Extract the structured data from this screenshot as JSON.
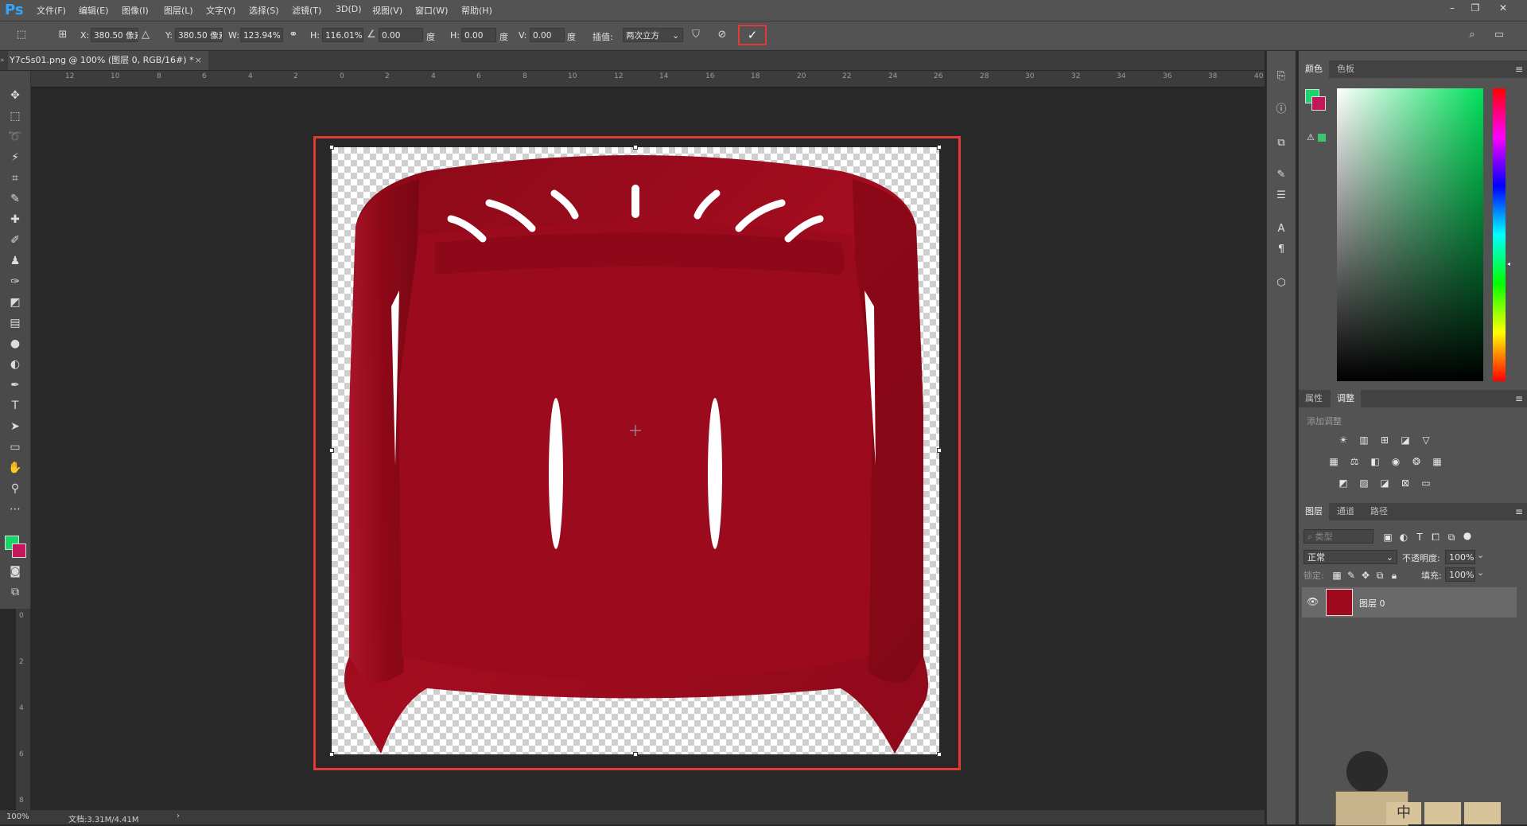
{
  "app": {
    "logo": "Ps"
  },
  "menubar": {
    "items": [
      "文件(F)",
      "编辑(E)",
      "图像(I)",
      "图层(L)",
      "文字(Y)",
      "选择(S)",
      "滤镜(T)",
      "3D(D)",
      "视图(V)",
      "窗口(W)",
      "帮助(H)"
    ]
  },
  "options": {
    "x_label": "X:",
    "x_value": "380.50 像素",
    "y_label": "Y:",
    "y_value": "380.50 像素",
    "w_label": "W:",
    "w_value": "123.94%",
    "h_label": "H:",
    "h_value": "116.01%",
    "angle_value": "0.00",
    "angle_unit": "度",
    "hskew_label": "H:",
    "hskew_value": "0.00",
    "hskew_unit": "度",
    "vskew_label": "V:",
    "vskew_value": "0.00",
    "vskew_unit": "度",
    "interp_label": "插值:",
    "interp_value": "两次立方"
  },
  "document": {
    "tab_title": "Y7c5s01.png @ 100% (图层 0, RGB/16#) *"
  },
  "rulers": {
    "h_labels": [
      "12",
      "10",
      "8",
      "6",
      "4",
      "2",
      "0",
      "2",
      "4",
      "6",
      "8",
      "10",
      "12",
      "14",
      "16",
      "18",
      "20",
      "22",
      "24",
      "26",
      "28",
      "30",
      "32",
      "34",
      "36",
      "38",
      "40"
    ],
    "v_labels": [
      "0",
      "2",
      "4",
      "6",
      "8"
    ]
  },
  "status": {
    "zoom": "100%",
    "doc_size": "文档:3.31M/4.41M"
  },
  "color_panel": {
    "tabs": [
      "颜色",
      "色板"
    ],
    "foreground": "#19d66b",
    "background": "#c2185b"
  },
  "adjust_panel": {
    "tabs": [
      "属性",
      "调整"
    ],
    "add_label": "添加调整"
  },
  "layers_panel": {
    "tabs": [
      "图层",
      "通道",
      "路径"
    ],
    "filter_placeholder": "类型",
    "blend_mode": "正常",
    "opacity_label": "不透明度:",
    "opacity_value": "100%",
    "lock_label": "锁定:",
    "fill_label": "填充:",
    "fill_value": "100%",
    "layers": [
      {
        "name": "图层 0"
      }
    ]
  },
  "overlay": {
    "ime_char": "中"
  },
  "colors": {
    "chair_red": "#a00a1e",
    "highlight_box": "#e53935",
    "accent": "#31a8ff"
  }
}
